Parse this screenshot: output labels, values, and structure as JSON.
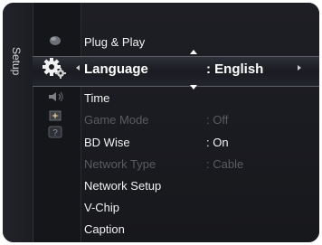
{
  "sidebar": {
    "label": "Setup",
    "icons": [
      "picture-icon",
      "setup-gear-icon",
      "sound-icon",
      "channel-icon",
      "help-icon"
    ]
  },
  "menu": {
    "items": [
      {
        "label": "Plug & Play",
        "value": "",
        "state": "normal"
      },
      {
        "label": "Language",
        "value": ": English",
        "state": "selected"
      },
      {
        "label": "Time",
        "value": "",
        "state": "normal"
      },
      {
        "label": "Game Mode",
        "value": ": Off",
        "state": "disabled"
      },
      {
        "label": "BD Wise",
        "value": ": On",
        "state": "normal"
      },
      {
        "label": "Network Type",
        "value": ": Cable",
        "state": "disabled"
      },
      {
        "label": "Network Setup",
        "value": "",
        "state": "normal"
      },
      {
        "label": "V-Chip",
        "value": "",
        "state": "normal"
      },
      {
        "label": "Caption",
        "value": "",
        "state": "normal"
      }
    ]
  }
}
